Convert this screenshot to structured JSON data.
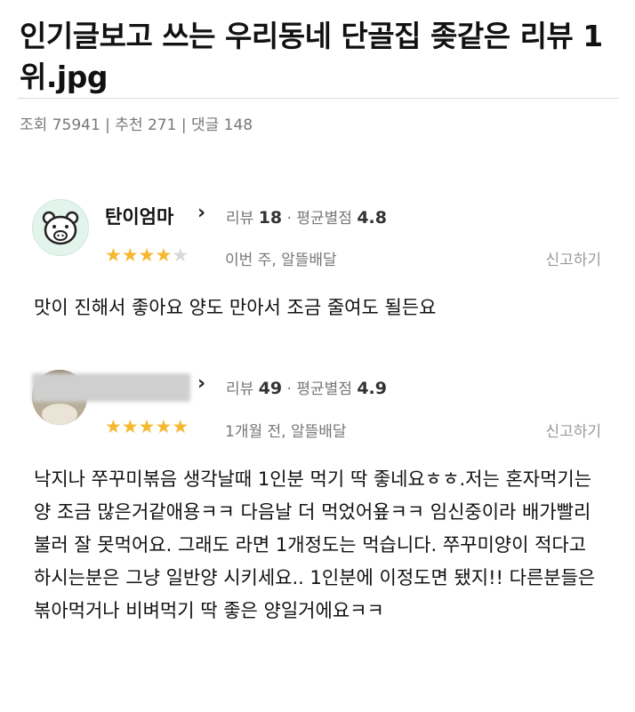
{
  "post": {
    "title": "인기글보고 쓰는 우리동네 단골집 좆같은 리뷰 1위.jpg",
    "meta": "조회 75941 | 추천 271 | 댓글 148"
  },
  "reviews": [
    {
      "name": "탄이엄마",
      "review_label": "리뷰",
      "review_count": "18",
      "avg_label": "평균별점",
      "avg_rating": "4.8",
      "stars": 4,
      "when": "이번 주, 알뜰배달",
      "report": "신고하기",
      "text": "맛이 진해서  좋아요  양도 만아서 조금 줄여도 될든요"
    },
    {
      "name": "",
      "review_label": "리뷰",
      "review_count": "49",
      "avg_label": "평균별점",
      "avg_rating": "4.9",
      "stars": 5,
      "when": "1개월 전, 알뜰배달",
      "report": "신고하기",
      "text": "낙지나 쭈꾸미볶음 생각날때 1인분 먹기 딱 좋네요ㅎㅎ.저는 혼자먹기는 양 조금 많은거같애용ㅋㅋ 다음날 더 먹었어욮ㅋㅋ 임신중이라 배가빨리불러 잘 못먹어요. 그래도 라면 1개정도는 먹습니다. 쭈꾸미양이 적다고 하시는분은 그냥 일반양 시키세요.. 1인분에 이정도면 됐지!! 다른분들은 볶아먹거나 비벼먹기 딱 좋은 양일거에요ㅋㅋ"
    }
  ],
  "icons": {
    "avatar1": "pig-face-icon",
    "avatar2": "profile-photo",
    "chevron": "chevron-right-icon",
    "star": "star-icon"
  },
  "colors": {
    "star": "#f5b82e",
    "star_empty": "#d8d8d8",
    "meta": "#777777"
  }
}
